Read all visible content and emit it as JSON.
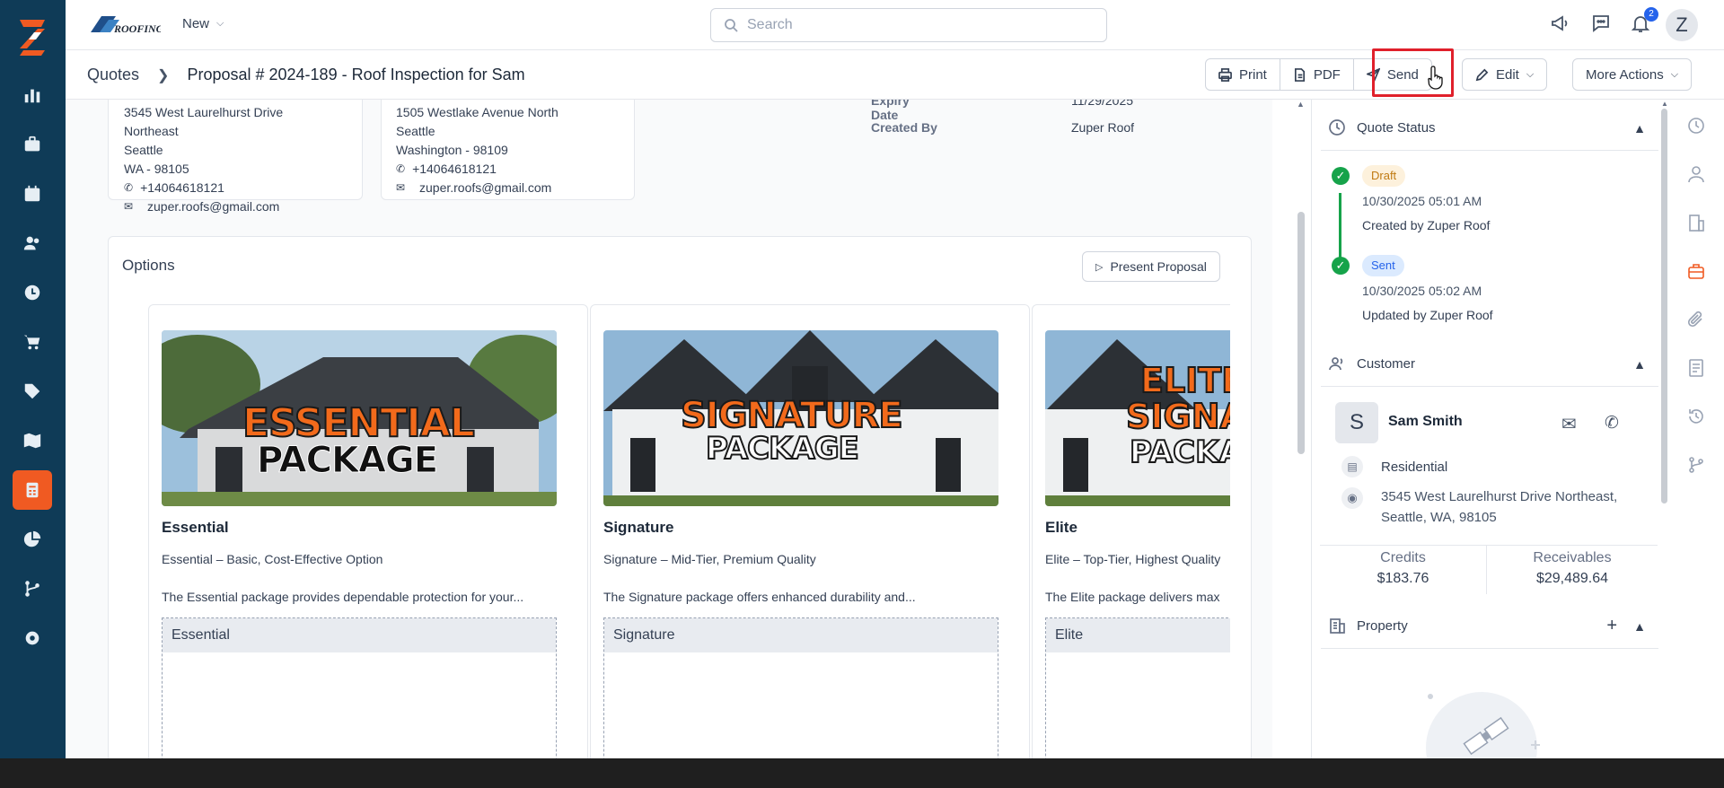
{
  "topbar": {
    "new_label": "New",
    "search_placeholder": "Search",
    "notification_count": "2",
    "avatar_initial": "Z"
  },
  "header": {
    "breadcrumb_root": "Quotes",
    "breadcrumb_title": "Proposal # 2024-189 - Roof Inspection for Sam",
    "actions": {
      "print": "Print",
      "pdf": "PDF",
      "send": "Send",
      "edit": "Edit",
      "more": "More Actions"
    }
  },
  "addresses": [
    {
      "lines": [
        "3545 West Laurelhurst Drive",
        "Northeast",
        "Seattle",
        "WA - 98105"
      ],
      "phone": "+14064618121",
      "email": "zuper.roofs@gmail.com"
    },
    {
      "lines": [
        "1505 Westlake Avenue North",
        "Seattle",
        "Washington - 98109"
      ],
      "phone": "+14064618121",
      "email": "zuper.roofs@gmail.com"
    }
  ],
  "details": {
    "expiry_label": "Expiry Date",
    "expiry_value": "11/29/2025",
    "created_by_label": "Created By",
    "created_by_value": "Zuper Roof"
  },
  "options": {
    "title": "Options",
    "present_label": "Present Proposal",
    "packages": [
      {
        "name": "Essential",
        "subtitle": "Essential – Basic, Cost-Effective Option",
        "description": "The Essential package provides dependable protection for your...",
        "table_header": "Essential",
        "banner_line1": "ESSENTIAL",
        "banner_line2": "PACKAGE"
      },
      {
        "name": "Signature",
        "subtitle": "Signature – Mid-Tier, Premium Quality",
        "description": "The Signature package offers enhanced durability and...",
        "table_header": "Signature",
        "banner_line1": "SIGNATURE",
        "banner_line2": "PACKAGE"
      },
      {
        "name": "Elite",
        "subtitle": "Elite – Top-Tier, Highest Quality",
        "description": "The Elite package delivers max",
        "table_header": "Elite",
        "banner_line1": "ELITE",
        "banner_line2": "SIGNATURE",
        "banner_line3": "PACKAGE"
      }
    ]
  },
  "quote_status": {
    "title": "Quote Status",
    "events": [
      {
        "badge": "Draft",
        "time": "10/30/2025 05:01 AM",
        "by": "Created by Zuper Roof"
      },
      {
        "badge": "Sent",
        "time": "10/30/2025 05:02 AM",
        "by": "Updated by Zuper Roof"
      }
    ]
  },
  "customer": {
    "title": "Customer",
    "initial": "S",
    "name": "Sam Smith",
    "type": "Residential",
    "address_line1": "3545 West Laurelhurst Drive Northeast,",
    "address_line2": "Seattle, WA, 98105",
    "credits_label": "Credits",
    "credits_value": "$183.76",
    "receivables_label": "Receivables",
    "receivables_value": "$29,489.64"
  },
  "property": {
    "title": "Property"
  },
  "colors": {
    "rail": "#0f3b57",
    "accent": "#f05a22",
    "highlight": "#e0202b",
    "success": "#16a34a"
  }
}
